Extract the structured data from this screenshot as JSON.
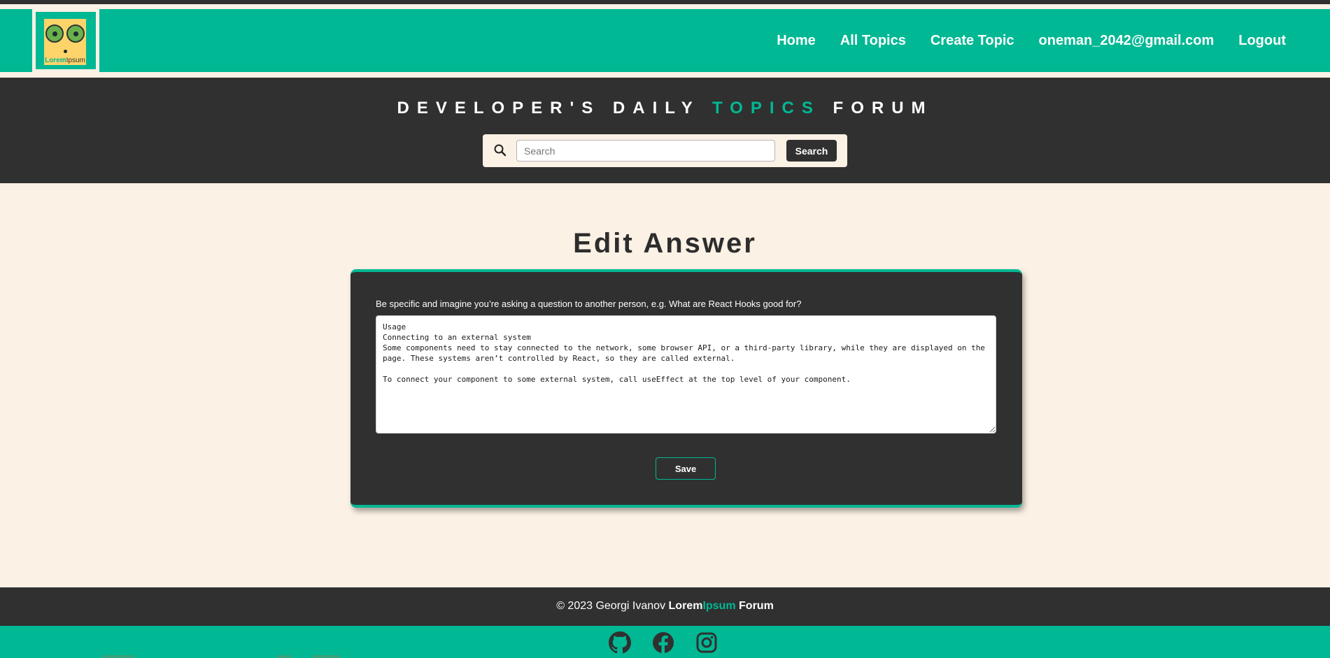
{
  "navbar": {
    "logo": {
      "text_part1": "Lorem",
      "text_part2": "Ipsum"
    },
    "links": [
      {
        "label": "Home"
      },
      {
        "label": "All Topics"
      },
      {
        "label": "Create Topic"
      },
      {
        "label": "oneman_2042@gmail.com"
      },
      {
        "label": "Logout"
      }
    ]
  },
  "hero": {
    "title_part1": "DEVELOPER'S DAILY",
    "title_accent": "TOPICS",
    "title_part2": "FORUM",
    "search": {
      "placeholder": "Search",
      "value": "",
      "button_label": "Search"
    }
  },
  "main": {
    "title": "Edit Answer",
    "form": {
      "label": "Be specific and imagine you’re asking a question to another person, e.g. What are React Hooks good for?",
      "textarea_value": "Usage\nConnecting to an external system\nSome components need to stay connected to the network, some browser API, or a third-party library, while they are displayed on the page. These systems aren’t controlled by React, so they are called external.\n\nTo connect your component to some external system, call useEffect at the top level of your component.",
      "save_label": "Save"
    }
  },
  "footer": {
    "copyright": "© 2023 Georgi Ivanov",
    "brand_lorem": "Lorem",
    "brand_ipsum": "Ipsum",
    "brand_forum": "Forum",
    "social_icons": [
      "github-icon",
      "facebook-icon",
      "instagram-icon"
    ]
  },
  "colors": {
    "accent": "#00b894",
    "dark": "#303030",
    "background": "#fbf1e5"
  }
}
